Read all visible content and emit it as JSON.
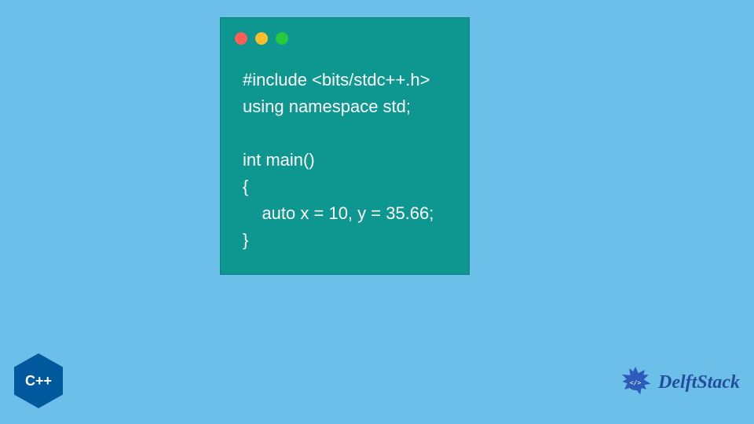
{
  "code": {
    "line1": "#include <bits/stdc++.h>",
    "line2": "using namespace std;",
    "line3": "",
    "line4": "int main()",
    "line5": "{",
    "line6": "    auto x = 10, y = 35.66;",
    "line7": "}"
  },
  "cpp_badge": {
    "label": "C++"
  },
  "brand": {
    "name": "DelftStack"
  },
  "colors": {
    "background": "#6cbfe8",
    "window": "#0e9790",
    "red": "#ff5f56",
    "yellow": "#ffbd2e",
    "green": "#27c93f",
    "cpp": "#00599c",
    "brand_text": "#244e9c"
  }
}
